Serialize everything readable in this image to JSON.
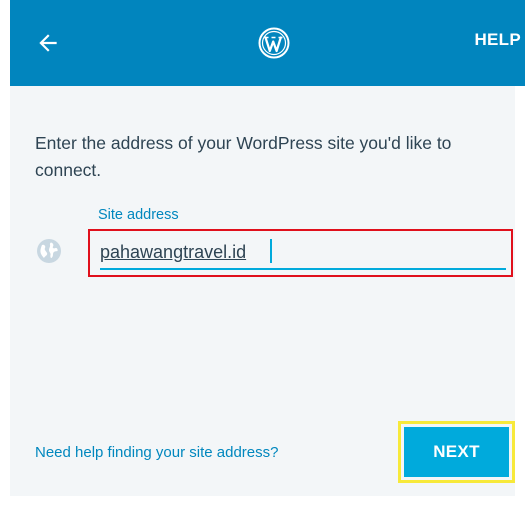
{
  "app_bar": {
    "back_icon": "arrow-left-icon",
    "logo_icon": "wordpress-logo-icon",
    "help_label": "HELP",
    "background_color": "#0185be"
  },
  "main": {
    "intro_text": "Enter the address of your WordPress site you'd like to connect.",
    "field_icon": "globe-icon",
    "site_address": {
      "label": "Site address",
      "value": "pahawangtravel.id"
    },
    "help_link": "Need help finding your site address?",
    "next_label": "NEXT"
  },
  "colors": {
    "accent": "#00aadc",
    "link": "#0087be",
    "text": "#2e4453",
    "highlight_red": "#e0101c",
    "highlight_yellow": "#f7e93a"
  }
}
